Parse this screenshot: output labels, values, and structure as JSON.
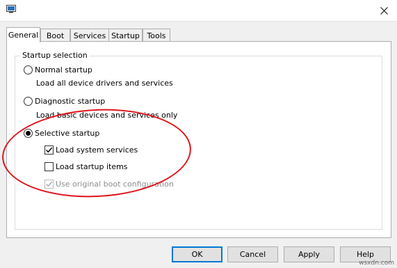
{
  "tabs": [
    {
      "label": "General",
      "active": true
    },
    {
      "label": "Boot",
      "active": false
    },
    {
      "label": "Services",
      "active": false
    },
    {
      "label": "Startup",
      "active": false
    },
    {
      "label": "Tools",
      "active": false
    }
  ],
  "startup_selection": {
    "title": "Startup selection",
    "normal": {
      "label": "Normal startup",
      "description": "Load all device drivers and services",
      "selected": false
    },
    "diagnostic": {
      "label": "Diagnostic startup",
      "description": "Load basic devices and services only",
      "selected": false
    },
    "selective": {
      "label": "Selective startup",
      "selected": true
    },
    "options": {
      "system_services": {
        "label": "Load system services",
        "checked": true
      },
      "startup_items": {
        "label": "Load startup items",
        "checked": false
      },
      "original_boot": {
        "label": "Use original boot configuration",
        "checked": true,
        "disabled": true
      }
    }
  },
  "buttons": {
    "ok": "OK",
    "cancel": "Cancel",
    "apply": "Apply",
    "help": "Help"
  },
  "watermark": "wsxdn.com",
  "colors": {
    "highlight": "#e0141c",
    "primary_border": "#0078d7"
  },
  "icons": {
    "app": "system-configuration-icon",
    "close": "close-icon"
  }
}
